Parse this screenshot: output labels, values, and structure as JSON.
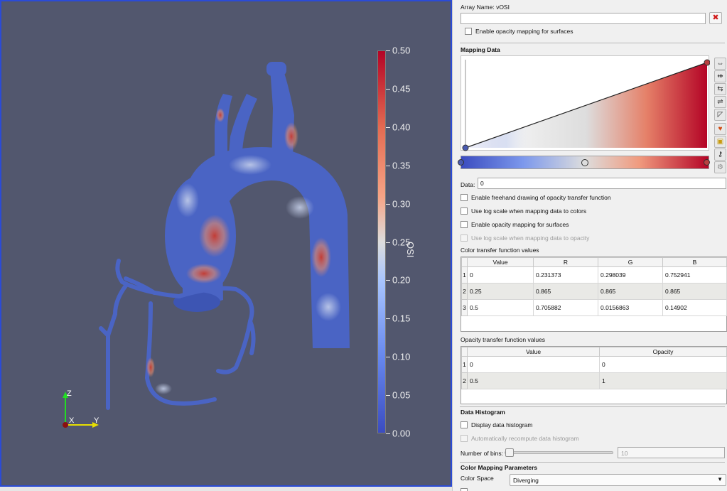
{
  "legend": {
    "title": "OSI",
    "ticks": [
      "0.50",
      "0.45",
      "0.40",
      "0.35",
      "0.30",
      "0.25",
      "0.20",
      "0.15",
      "0.10",
      "0.05",
      "0.00"
    ]
  },
  "axes": {
    "z": "Z",
    "x": "X",
    "y": "Y"
  },
  "panel": {
    "array_name": "Array Name: vOSI",
    "top_search_value": "",
    "top_opacity_checkbox": "Enable opacity mapping for surfaces",
    "mapping_data_title": "Mapping Data",
    "data_label": "Data:",
    "data_value": "0",
    "options": [
      {
        "label": "Enable freehand drawing of opacity transfer function",
        "checked": false,
        "enabled": true
      },
      {
        "label": "Use log scale when mapping data to colors",
        "checked": false,
        "enabled": true
      },
      {
        "label": "Enable opacity mapping for surfaces",
        "checked": false,
        "enabled": true
      },
      {
        "label": "Use log scale when mapping data to opacity",
        "checked": false,
        "enabled": false
      }
    ],
    "color_tf_title": "Color transfer function values",
    "color_tf_headers": [
      "Value",
      "R",
      "G",
      "B"
    ],
    "color_tf_rows": [
      [
        "1",
        "0",
        "0.231373",
        "0.298039",
        "0.752941"
      ],
      [
        "2",
        "0.25",
        "0.865",
        "0.865",
        "0.865"
      ],
      [
        "3",
        "0.5",
        "0.705882",
        "0.0156863",
        "0.14902"
      ]
    ],
    "opacity_tf_title": "Opacity transfer function values",
    "opacity_tf_headers": [
      "Value",
      "Opacity"
    ],
    "opacity_tf_rows": [
      [
        "1",
        "0",
        "0"
      ],
      [
        "2",
        "0.5",
        "1"
      ]
    ],
    "histogram_title": "Data Histogram",
    "display_histogram": "Display data histogram",
    "auto_recompute": "Automatically recompute data histogram",
    "bins_label": "Number of bins:",
    "bins_value": "10",
    "color_params_title": "Color Mapping Parameters",
    "color_space_label": "Color Space",
    "color_space_value": "Diverging"
  },
  "colors": {
    "background": "#52576e",
    "low": "#3b4cc0",
    "mid": "#dddddd",
    "high": "#b40426"
  }
}
